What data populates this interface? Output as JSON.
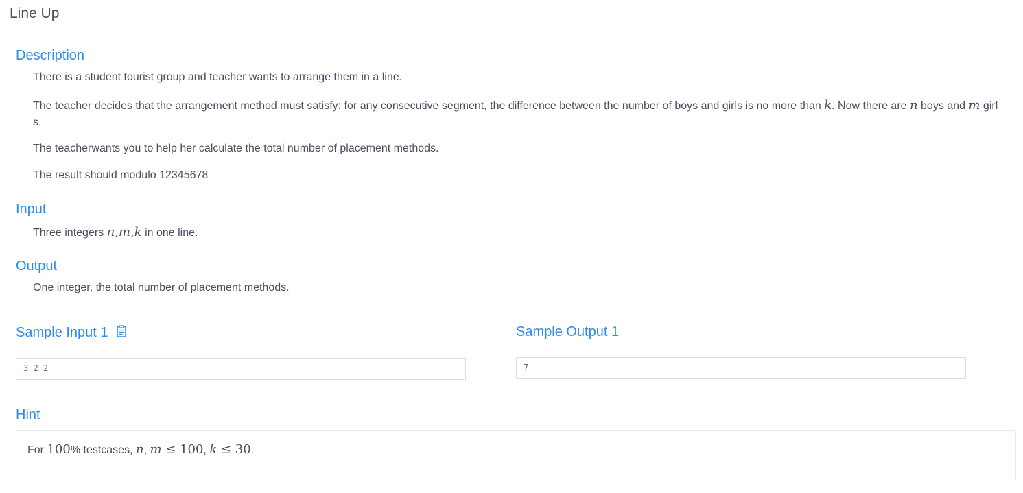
{
  "problem": {
    "title": "Line Up"
  },
  "description": {
    "heading": "Description",
    "p1": "There is a student tourist group and teacher wants to arrange them in a line.",
    "p2_a": "The teacher decides that the arrangement method must satisfy: for any consecutive segment, the difference between the number of boys and girls is no more than ",
    "p2_k": "k",
    "p2_b": ". Now there are ",
    "p2_n": "n",
    "p2_c": " boys and ",
    "p2_m": "m",
    "p2_d": " girl",
    "p2_e": "s.",
    "p3": "The teacherwants you to help her calculate the total number of placement methods.",
    "p4": "The result should modulo 12345678"
  },
  "input": {
    "heading": "Input",
    "text_a": "Three integers ",
    "math": "n,m,k",
    "text_b": " in one line."
  },
  "output": {
    "heading": "Output",
    "text": "One integer, the total number of placement methods."
  },
  "samples": {
    "input_heading": "Sample Input 1",
    "input_value": "3 2 2",
    "output_heading": "Sample Output 1",
    "output_value": "7",
    "copy_icon": "clipboard-icon"
  },
  "hint": {
    "heading": "Hint",
    "text_a": "For ",
    "pct_num": "100",
    "text_b": "% testcases, ",
    "m1": "n",
    "t1": ", ",
    "m2": "m",
    "le1": " ≤ ",
    "num1": "100",
    "t2": ", ",
    "m3": "k",
    "le2": " ≤ ",
    "num2": "30",
    "t3": "."
  },
  "colors": {
    "accent": "#2d8cf0",
    "text": "#495060",
    "border": "#dddee1"
  }
}
